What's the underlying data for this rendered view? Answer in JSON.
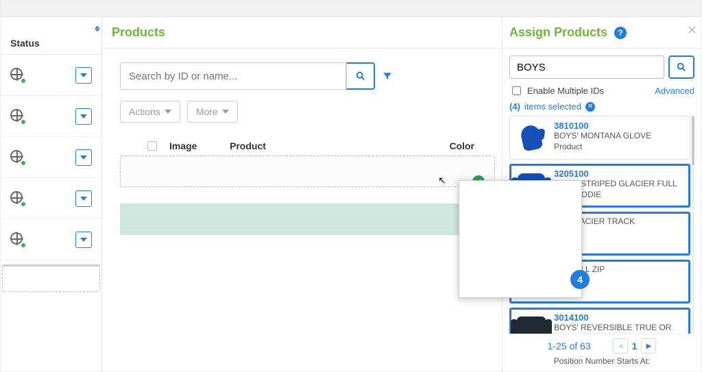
{
  "left": {
    "status_title": "Status",
    "row_count": 5
  },
  "mid": {
    "title": "Products",
    "search_placeholder": "Search by ID or name...",
    "actions_label": "Actions",
    "more_label": "More",
    "cols": {
      "image": "Image",
      "product": "Product",
      "color": "Color"
    }
  },
  "right": {
    "title": "Assign Products",
    "search_value": "BOYS",
    "enable_multiple": "Enable Multiple IDs",
    "advanced": "Advanced",
    "selected_prefix": "(4)",
    "selected_text": "items selected",
    "pager_text": "1-25 of 63",
    "page_input": "1",
    "position_label": "Position Number Starts At:",
    "drag_count": "4",
    "cards": [
      {
        "id": "3810100",
        "name": "BOYS' MONTANA GLOVE",
        "sub": "Product",
        "thumb": "glove",
        "selected": false
      },
      {
        "id": "3205100",
        "name": "BOYS' STRIPED GLACIER FULL ZIP HOODIE",
        "sub": "",
        "thumb": "hoodie",
        "selected": true
      },
      {
        "id": "",
        "name": "RIL GLACIER TRACK",
        "sub": "",
        "thumb": "",
        "selected": true
      },
      {
        "id": "",
        "name": "IER FULL ZIP",
        "sub": "",
        "thumb": "",
        "selected": true
      },
      {
        "id": "3014100",
        "name": "BOYS' REVERSIBLE TRUE OR FALSE JACKET",
        "sub": "",
        "thumb": "jacket",
        "selected": true
      }
    ]
  }
}
